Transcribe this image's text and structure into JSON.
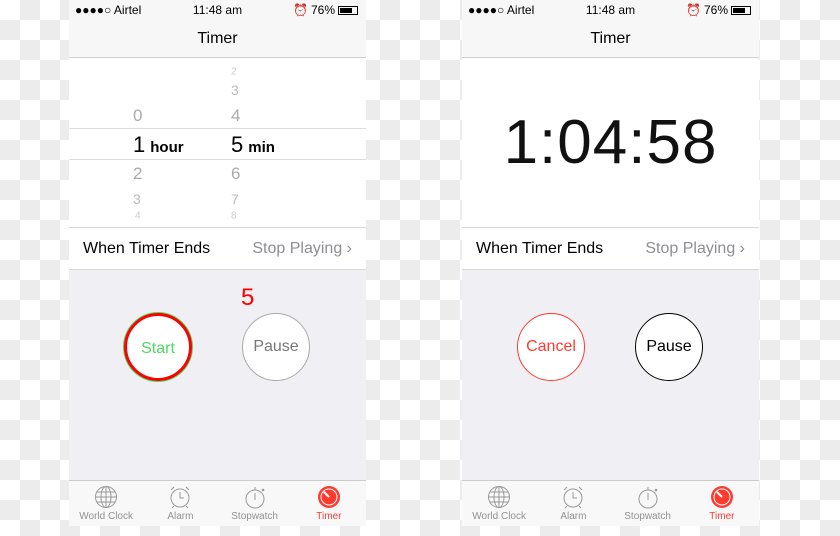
{
  "status": {
    "carrier": "●●●●○ Airtel",
    "time": "11:48 am",
    "battery": "76%"
  },
  "nav_title": "Timer",
  "picker": {
    "hours_above": [
      "0"
    ],
    "hours_selected": "1",
    "hours_unit": "hour",
    "hours_below": [
      "2",
      "3",
      "4"
    ],
    "minutes_above": [
      "2",
      "3",
      "4"
    ],
    "minutes_selected": "5",
    "minutes_unit": "min",
    "minutes_below": [
      "6",
      "7",
      "8"
    ]
  },
  "countdown": "1:04:58",
  "row": {
    "label": "When Timer Ends",
    "value": "Stop Playing"
  },
  "left_buttons": {
    "start": "Start",
    "pause": "Pause"
  },
  "annotation": "5",
  "right_buttons": {
    "cancel": "Cancel",
    "pause": "Pause"
  },
  "tabs": [
    {
      "label": "World Clock",
      "icon": "globe-icon"
    },
    {
      "label": "Alarm",
      "icon": "alarm-clock-icon"
    },
    {
      "label": "Stopwatch",
      "icon": "stopwatch-icon"
    },
    {
      "label": "Timer",
      "icon": "timer-icon",
      "active": true
    }
  ],
  "colors": {
    "accent": "#ff3b30",
    "start": "#4cd964"
  }
}
